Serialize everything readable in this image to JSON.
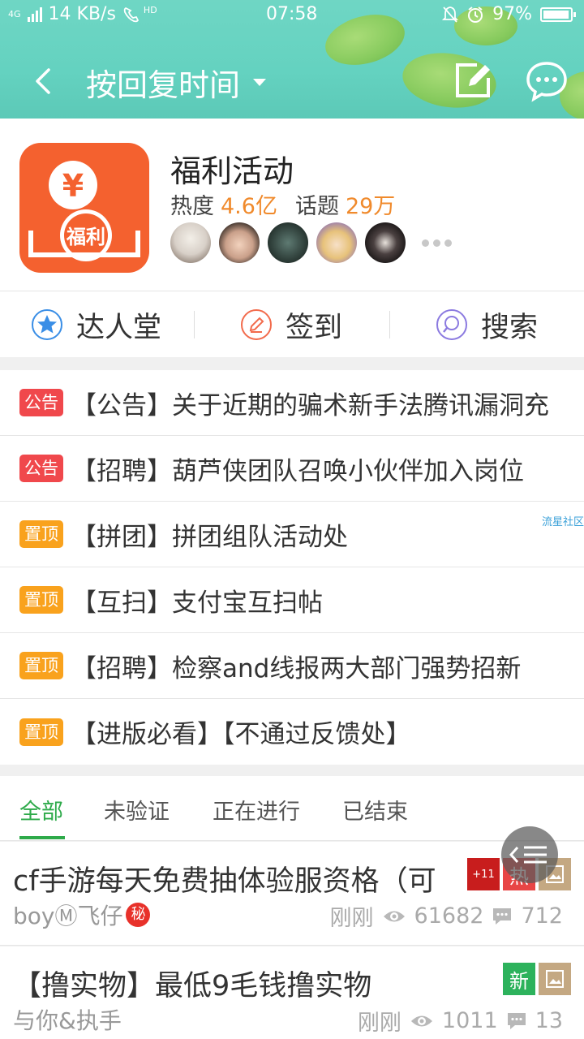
{
  "status_bar": {
    "network": "4G",
    "speed": "14 KB/s",
    "call_badge": "HD",
    "time": "07:58",
    "battery": "97%",
    "battery_level": 0.97
  },
  "nav": {
    "title": "按回复时间",
    "back_icon": "chevron-left-icon",
    "edit_icon": "edit-icon",
    "chat_icon": "chat-bubble-icon"
  },
  "forum": {
    "name": "福利活动",
    "logo_text_top": "¥",
    "logo_text": "福利",
    "heat_label": "热度",
    "heat_value": "4.6亿",
    "topics_label": "话题",
    "topics_value": "29万"
  },
  "actions": [
    {
      "label": "达人堂",
      "icon": "star-badge-icon"
    },
    {
      "label": "签到",
      "icon": "pencil-circle-icon"
    },
    {
      "label": "搜索",
      "icon": "search-icon"
    }
  ],
  "notices": [
    {
      "tag": "公告",
      "color": "#f0484c",
      "text": "【公告】关于近期的骗术新手法腾讯漏洞充"
    },
    {
      "tag": "公告",
      "color": "#f0484c",
      "text": "【招聘】葫芦侠团队召唤小伙伴加入岗位"
    },
    {
      "tag": "置顶",
      "color": "#f9a21d",
      "text": "【拼团】拼团组队活动处"
    },
    {
      "tag": "置顶",
      "color": "#f9a21d",
      "text": "【互扫】支付宝互扫帖"
    },
    {
      "tag": "置顶",
      "color": "#f9a21d",
      "text": "【招聘】检察and线报两大部门强势招新"
    },
    {
      "tag": "置顶",
      "color": "#f9a21d",
      "text": "【进版必看】【不通过反馈处】"
    }
  ],
  "watermark": "流星社区",
  "tabs": [
    {
      "label": "全部",
      "active": true
    },
    {
      "label": "未验证",
      "active": false
    },
    {
      "label": "正在进行",
      "active": false
    },
    {
      "label": "已结束",
      "active": false
    }
  ],
  "posts": [
    {
      "title": "cf手游每天免费抽体验服资格（可",
      "author": "boyⓂ飞仔",
      "author_badge": "秘",
      "time": "刚刚",
      "views": "61682",
      "replies": "712",
      "badges": [
        "+11",
        "热",
        "img"
      ]
    },
    {
      "title": "【撸实物】最低9毛钱撸实物",
      "author": "与你&执手",
      "time": "刚刚",
      "views": "1011",
      "replies": "13",
      "badges": [
        "新",
        "img"
      ]
    }
  ],
  "colors": {
    "accent_green": "#2eaa4a",
    "header_teal": "#64d2c0",
    "stat_orange": "#f08a2c",
    "logo_orange": "#f4612f"
  }
}
